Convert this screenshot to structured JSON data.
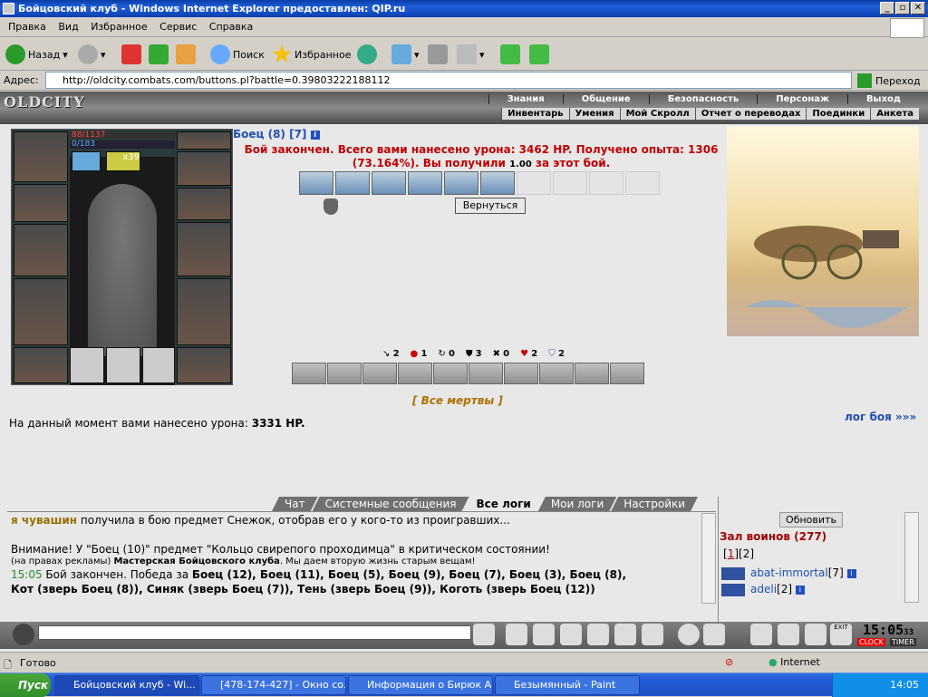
{
  "window": {
    "title": "Бойцовский клуб - Windows Internet Explorer предоставлен: QIP.ru"
  },
  "menu": [
    "Правка",
    "Вид",
    "Избранное",
    "Сервис",
    "Справка"
  ],
  "toolbar": {
    "back": "Назад",
    "search": "Поиск",
    "favorites": "Избранное"
  },
  "address": {
    "label": "Адрес:",
    "url": "http://oldcity.combats.com/buttons.pl?battle=0.39803222188112",
    "go": "Переход"
  },
  "game": {
    "logo": "OLDCITY",
    "nav_top": [
      "Знания",
      "Общение",
      "Безопасность",
      "Персонаж",
      "Выход"
    ],
    "nav_sub": [
      "Инвентарь",
      "Умения",
      "Мой Скролл",
      "Отчет о переводах",
      "Поединки",
      "Анкета"
    ],
    "hp": "88/1137",
    "mana": "0/183",
    "item_count": "x39",
    "fighter": "Боец (8) [7]",
    "battle_msg": "Бой закончен. Всего вами нанесено урона: 3462 HP. Получено опыта: 1306 (73.164%). Вы получили",
    "battle_reward": "1.00",
    "battle_msg_end": "за этот бой.",
    "return_btn": "Вернуться",
    "stats": [
      "2",
      "1",
      "0",
      "3",
      "0",
      "2",
      "2"
    ],
    "all_dead": "[ Все мертвы ]",
    "log_link": "лог боя »»»",
    "damage_label": "На данный момент вами нанесено урона:",
    "damage_value": "3331 HP."
  },
  "chat": {
    "tabs": [
      "Чат",
      "Системные сообщения",
      "Все логи",
      "Мои логи",
      "Настройки"
    ],
    "line1_name": "я чувашин",
    "line1_text": "получила в бою предмет Снежок, отобрав его у кого-то из проигравших...",
    "line2": "Внимание! У \"Боец (10)\" предмет \"Кольцо свирепого проходимца\" в критическом состоянии!",
    "ad_prefix": "(на правах рекламы)",
    "ad_bold": "Мастерская Бойцовского клуба",
    "ad_text": ". Мы даем вторую жизнь старым вещам!",
    "line4_time": "15:05",
    "line4_text": "Бой закончен. Победа за",
    "line4_list": "Боец (12), Боец (11), Боец (5), Боец (9), Боец (7), Боец (3), Боец (8),",
    "line5": "Кот (зверь Боец (8)), Синяк (зверь Боец (7)), Тень (зверь Боец (9)), Коготь (зверь Боец (12))"
  },
  "room": {
    "refresh": "Обновить",
    "title": "Зал воинов (277)",
    "page1": "1",
    "page2": "2",
    "users": [
      {
        "name": "abat-immortal",
        "level": "[7]"
      },
      {
        "name": "adeli",
        "level": "[2]"
      }
    ]
  },
  "bottom": {
    "clock": "15:05",
    "clock_sec": "33",
    "clock_label": "CLOCK",
    "timer_label": "TIMER",
    "exit": "EXIT"
  },
  "status": {
    "text": "Готово",
    "zone": "Internet"
  },
  "taskbar": {
    "start": "Пуск",
    "tasks": [
      "Бойцовский клуб - Wi...",
      "[478-174-427] - Окно со...",
      "Информация о Бирюк А...",
      "Безымянный - Paint"
    ],
    "time": "14:05"
  }
}
